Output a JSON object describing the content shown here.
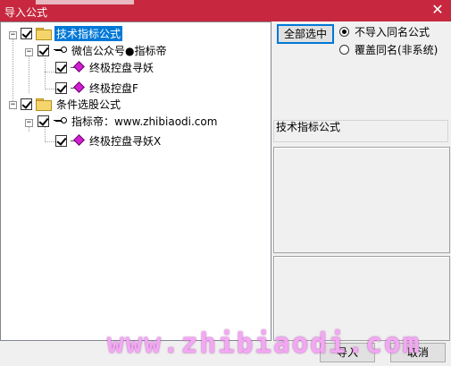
{
  "window": {
    "title": "导入公式",
    "close_glyph": "✕"
  },
  "tree": {
    "items": [
      {
        "label": "技术指标公式",
        "checked": true,
        "expanded": true,
        "icon": "folder-icon",
        "selected": true
      },
      {
        "label": "微信公众号●指标帝",
        "checked": true,
        "expanded": true,
        "icon": "key-icon"
      },
      {
        "label": "终极控盘寻妖",
        "checked": true,
        "icon": "formula-icon"
      },
      {
        "label": "终极控盘F",
        "checked": true,
        "icon": "formula-icon"
      },
      {
        "label": "条件选股公式",
        "checked": true,
        "expanded": true,
        "icon": "folder-icon"
      },
      {
        "label": "指标帝：www.zhibiaodi.com",
        "checked": true,
        "expanded": true,
        "icon": "key-icon"
      },
      {
        "label": "终极控盘寻妖X",
        "checked": true,
        "icon": "formula-icon"
      }
    ]
  },
  "controls": {
    "select_all_label": "全部选中",
    "radio_skip_label": "不导入同名公式",
    "radio_overwrite_label": "覆盖同名(非系统)",
    "selected_radio": "skip"
  },
  "detail": {
    "category_label": "技术指标公式"
  },
  "footer": {
    "ok_label": "导入",
    "cancel_label": "取消"
  },
  "watermark": "www.zhibiaodi.com",
  "colors": {
    "titlebar": "#c7283f",
    "selection": "#0078d7",
    "watermark": "#f3a8f3"
  }
}
